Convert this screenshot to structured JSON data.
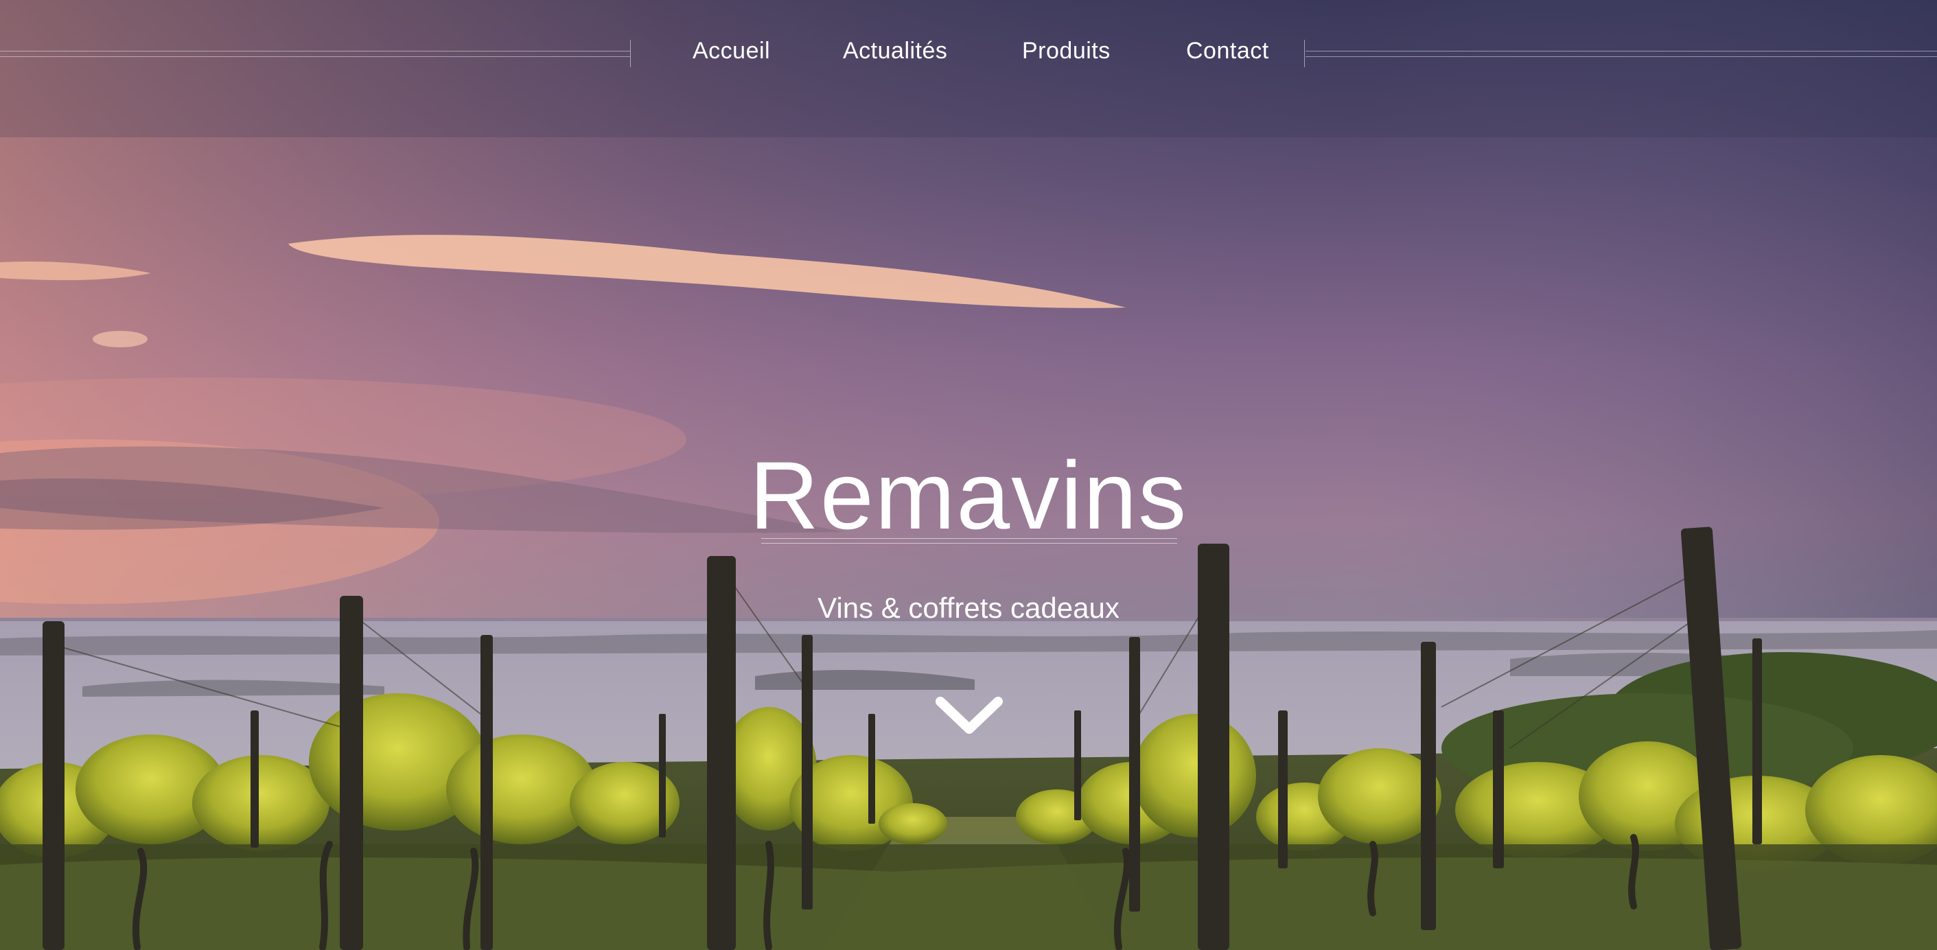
{
  "nav": {
    "items": [
      {
        "label": "Accueil"
      },
      {
        "label": "Actualités"
      },
      {
        "label": "Produits"
      },
      {
        "label": "Contact"
      }
    ]
  },
  "hero": {
    "title": "Remavins",
    "subtitle": "Vins & coffrets cadeaux",
    "scroll_icon": "chevron-down-icon",
    "background": "vineyard-sunset-photo"
  },
  "colors": {
    "sky_top": "#3b3c5e",
    "sky_mid": "#8a6c8e",
    "sky_glow": "#e8a08a",
    "mist": "#b9b3c2",
    "vine_leaf": "#c6c936",
    "grass": "#4f5a2a",
    "text": "#ffffff"
  }
}
